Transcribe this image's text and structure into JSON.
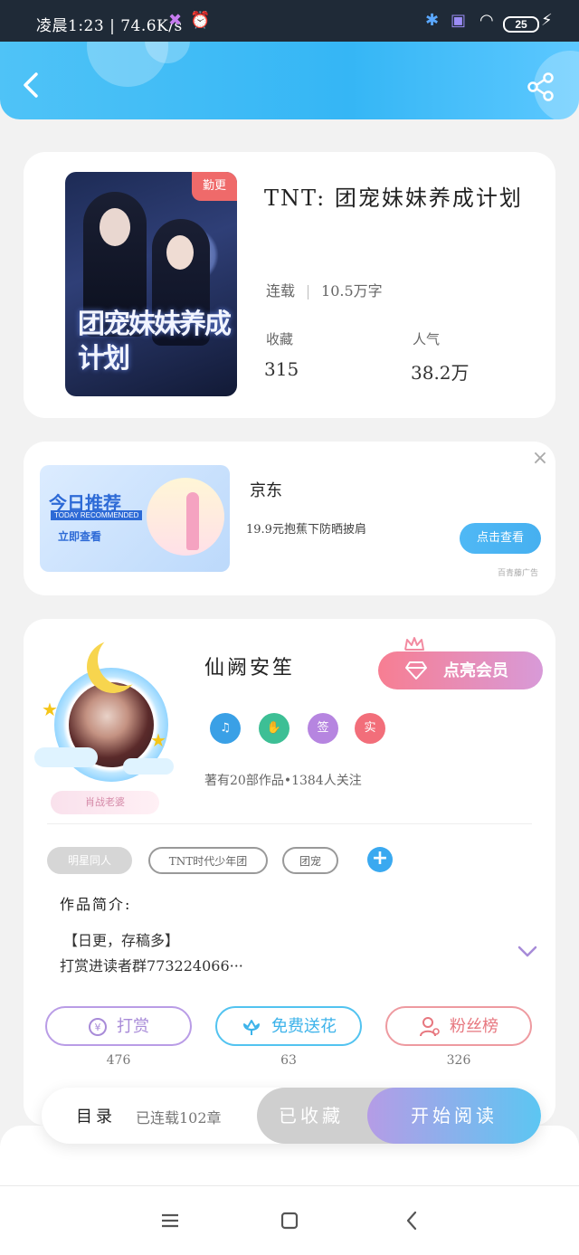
{
  "status_bar": {
    "time": "凌晨1:23 | 74.6K/s",
    "battery": "25"
  },
  "book": {
    "title": "TNT: 团宠妹妹养成计划",
    "cover_tag": "勤更",
    "cover_text": "团宠妹妹养成计划",
    "status": "连载",
    "word_count": "10.5万字",
    "favorites_label": "收藏",
    "favorites_value": "315",
    "popularity_label": "人气",
    "popularity_value": "38.2万"
  },
  "ad": {
    "banner_title": "今日推荐",
    "banner_subtitle": "TODAY RECOMMENDED",
    "banner_cta": "立即查看",
    "title": "京东",
    "description": "19.9元抱蕉下防晒披肩",
    "button": "点击查看",
    "source": "百青藤广告"
  },
  "author": {
    "name": "仙阙安笙",
    "vip_button": "点亮会员",
    "badge_label": "肖战老婆",
    "badges": [
      {
        "icon": "music-note-icon",
        "text": "♫",
        "color": "#3aa0e6"
      },
      {
        "icon": "handshake-icon",
        "text": "✋",
        "color": "#3dbf95"
      },
      {
        "icon": "sign-icon",
        "text": "签",
        "color": "#b685e0"
      },
      {
        "icon": "real-name-icon",
        "text": "实",
        "color": "#f26e7a"
      }
    ],
    "stats": "著有20部作品•1384人关注"
  },
  "tags": [
    "明星同人",
    "TNT时代少年团",
    "团宠"
  ],
  "intro": {
    "label": "作品简介:",
    "line1": "【日更，存稿多】",
    "line2": "打赏进读者群773224066···"
  },
  "actions": [
    {
      "label": "打赏",
      "count": "476"
    },
    {
      "label": "免费送花",
      "count": "63"
    },
    {
      "label": "粉丝榜",
      "count": "326"
    }
  ],
  "read_bar": {
    "toc_label": "目录",
    "toc_info": "已连载102章",
    "collected": "已收藏",
    "start": "开始阅读"
  }
}
